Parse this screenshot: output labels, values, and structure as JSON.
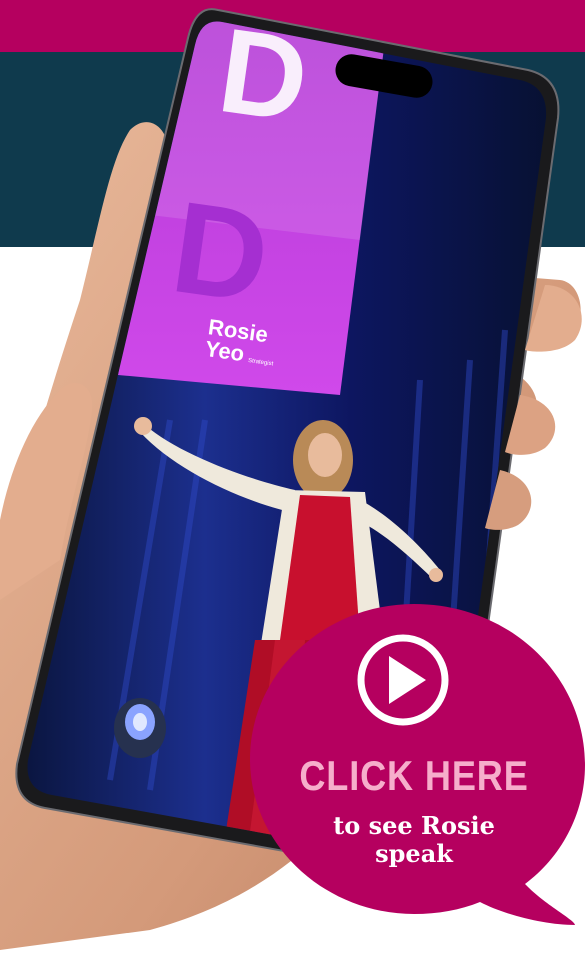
{
  "colors": {
    "brand_magenta": "#b5005f",
    "teal": "#0f3a4d",
    "cta_title": "#f6aecb",
    "screen_purple": "#c43de0"
  },
  "screen": {
    "logo_line1": "Rosie",
    "logo_line2": "Yeo",
    "logo_small": "Strategist"
  },
  "cta": {
    "icon": "play-icon",
    "title": "CLICK HERE",
    "line1": "to see Rosie",
    "line2": "speak"
  }
}
